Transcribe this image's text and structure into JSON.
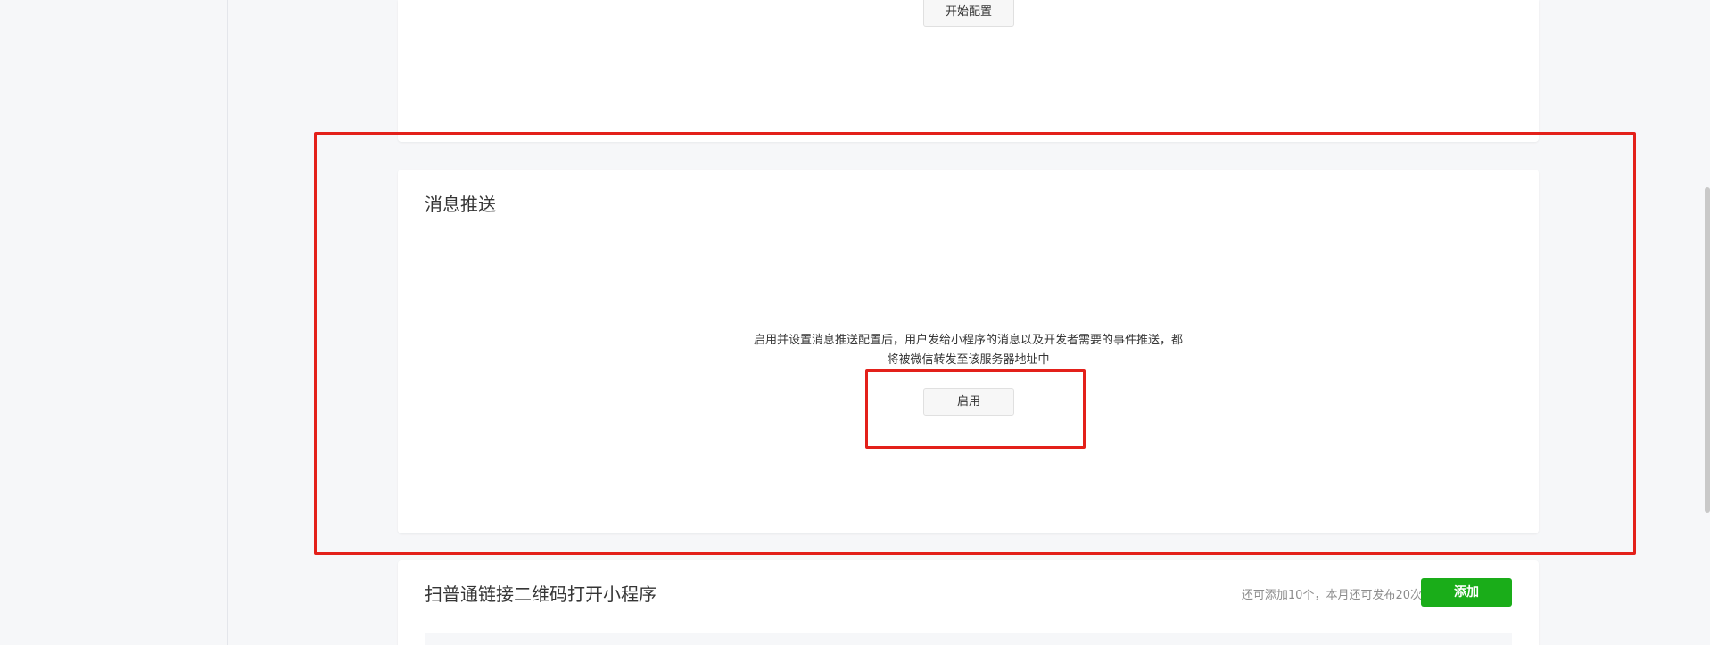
{
  "config_section": {
    "start_button_label": "开始配置"
  },
  "message_push": {
    "title": "消息推送",
    "description": "启用并设置消息推送配置后，用户发给小程序的消息以及开发者需要的事件推送，都将被微信转发至该服务器地址中",
    "enable_button_label": "启用"
  },
  "qrcode_section": {
    "title": "扫普通链接二维码打开小程序",
    "quota_text": "还可添加10个，本月还可发布20次。",
    "add_button_label": "添加"
  },
  "colors": {
    "accent_green": "#1aad19",
    "highlight_red": "#e3201a",
    "page_bg": "#f6f7f9"
  }
}
